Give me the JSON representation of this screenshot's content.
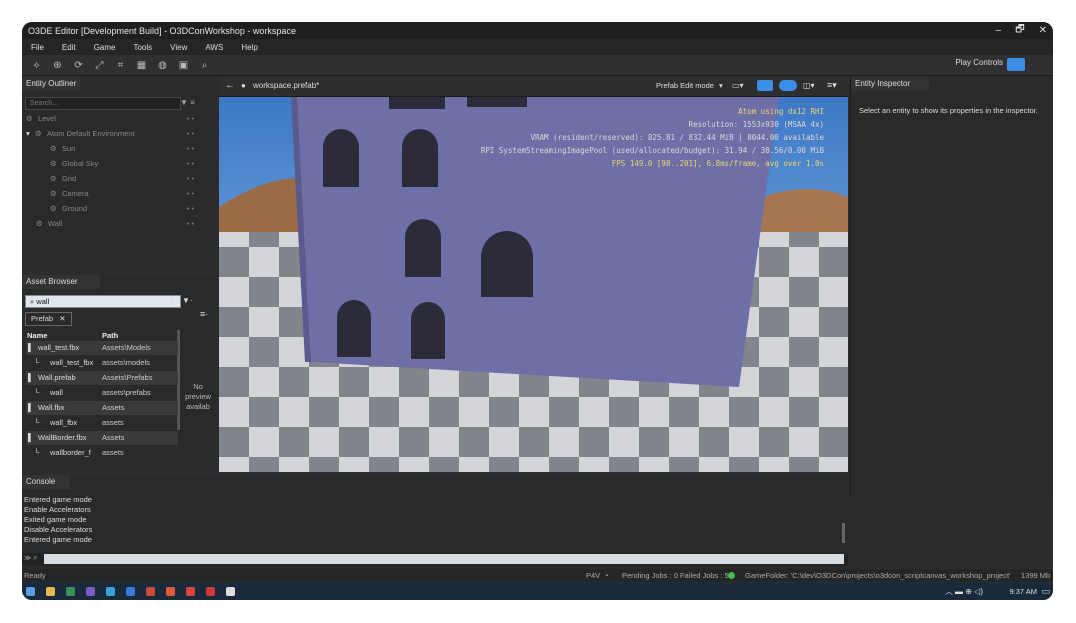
{
  "window": {
    "title": "O3DE Editor [Development Build] - O3DConWorkshop - workspace",
    "controls": [
      "–",
      "🗗",
      "✕"
    ]
  },
  "menu": [
    "File",
    "Edit",
    "Game",
    "Tools",
    "View",
    "AWS",
    "Help"
  ],
  "toolbar": {
    "play_controls_label": "Play Controls"
  },
  "entity_outliner": {
    "tab": "Entity Outliner",
    "search_placeholder": "Search...",
    "items": [
      {
        "label": "Level",
        "indent": 0
      },
      {
        "label": "Atom Default Environment",
        "indent": 1
      },
      {
        "label": "Sun",
        "indent": 2
      },
      {
        "label": "Global Sky",
        "indent": 2
      },
      {
        "label": "Grid",
        "indent": 2
      },
      {
        "label": "Camera",
        "indent": 2
      },
      {
        "label": "Ground",
        "indent": 2
      },
      {
        "label": "Wall",
        "indent": 1
      }
    ]
  },
  "asset_browser": {
    "tab": "Asset Browser",
    "search_value": "wall",
    "filter_chip": "Prefab",
    "col_name": "Name",
    "col_path": "Path",
    "rows": [
      {
        "name": "wall_test.fbx",
        "path": "Assets\\Models",
        "sel": true
      },
      {
        "name": "wall_test_fbx",
        "path": "assets\\models",
        "sel": false
      },
      {
        "name": "Wall.prefab",
        "path": "Assets\\Prefabs",
        "sel": true
      },
      {
        "name": "wall",
        "path": "assets\\prefabs",
        "sel": false
      },
      {
        "name": "Wall.fbx",
        "path": "Assets",
        "sel": true
      },
      {
        "name": "wall_fbx",
        "path": "assets",
        "sel": false
      },
      {
        "name": "WallBorder.fbx",
        "path": "Assets",
        "sel": true
      },
      {
        "name": "wallborder_f",
        "path": "assets",
        "sel": false
      }
    ],
    "no_preview": "No preview availab"
  },
  "viewport": {
    "tab": "workspace.prefab*",
    "mode": "Prefab Edit mode",
    "overlay": [
      "Atom using dx12 RHI",
      "Resolution: 1553x930 (MSAA 4x)",
      "VRAM (resident/reserved): 825.81 / 832.44 MiB | 8044.00 available",
      "RPI SystemStreamingImagePool (used/allocated/budget): 31.94 / 38.56/0.00 MiB",
      "FPS 149.0 [98..201], 6.8ms/frame, avg over 1.0s"
    ],
    "overlay_colors": [
      "#e8d56a",
      "#d8d8d8",
      "#d8d8d8",
      "#d8d8d8",
      "#e8d56a"
    ]
  },
  "inspector": {
    "tab": "Entity Inspector",
    "message": "Select an entity to show its properties in the inspector."
  },
  "console": {
    "tab": "Console",
    "lines": [
      "Entered game mode",
      "Enable Accelerators",
      "Exited game mode",
      "Disable Accelerators",
      "Entered game mode"
    ],
    "cmd_label": "≫"
  },
  "statusbar": {
    "ready": "Ready",
    "p4v": "P4V",
    "jobs": "Pending Jobs : 0  Failed Jobs : 5",
    "game_folder": "GameFolder: 'C:\\dev\\O3DCon\\projects\\o3dcon_scriptcanvas_workshop_project'",
    "mem": "1399 Mb"
  },
  "taskbar": {
    "time": "9:37 AM",
    "icon_colors": [
      "#5aa0e0",
      "#e6b94a",
      "#3d8f5a",
      "#7b5cc4",
      "#3aa0d8",
      "#3a7ad8",
      "#cc4a3a",
      "#e05a3a",
      "#d9453a",
      "#cc3a3a",
      "#dddddd"
    ]
  }
}
